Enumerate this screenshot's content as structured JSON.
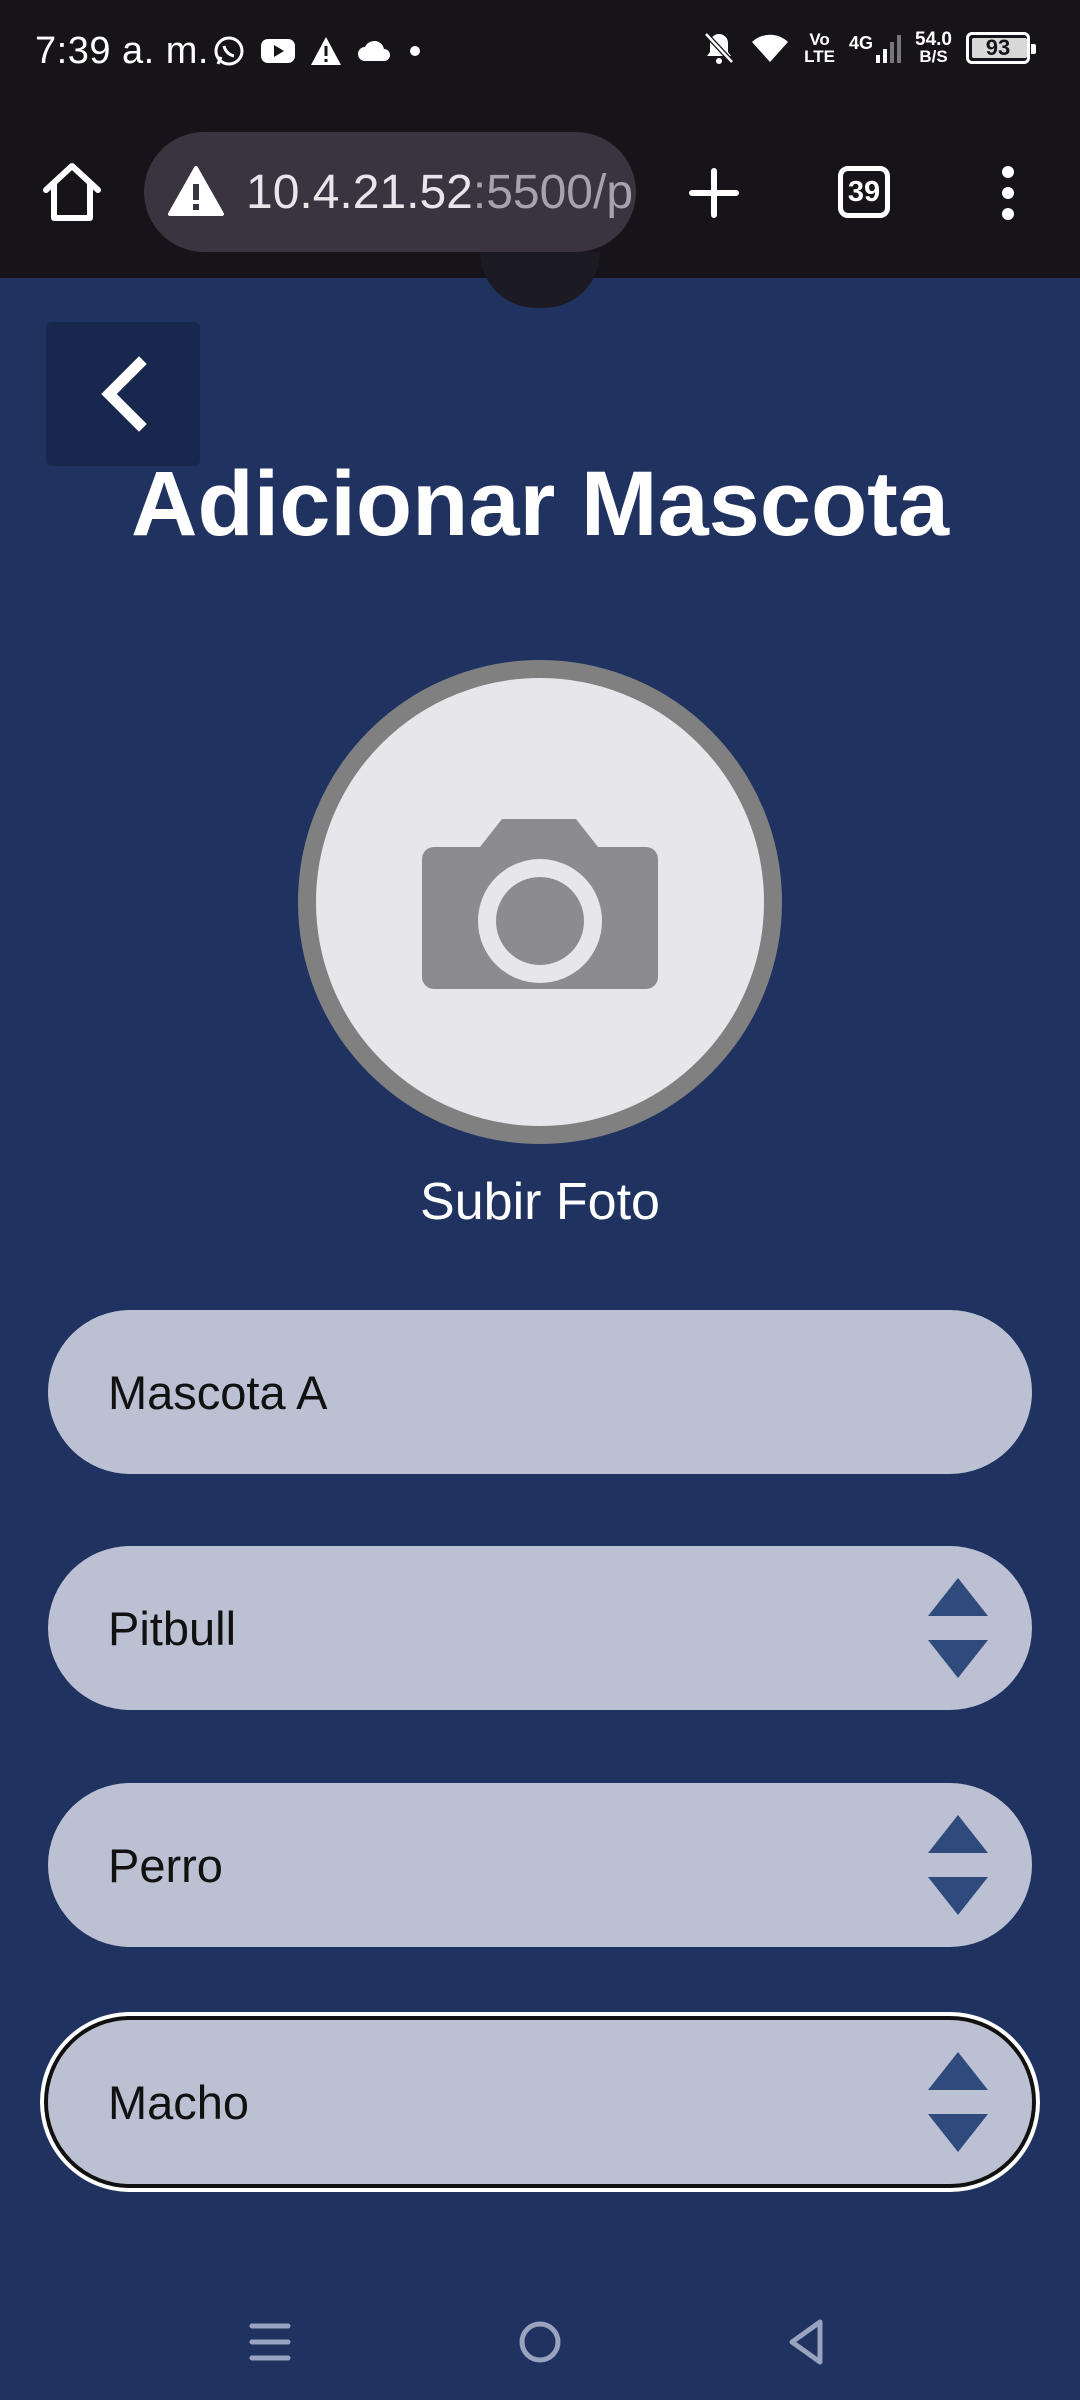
{
  "status_bar": {
    "time": "7:39 a. m.",
    "left_icons": [
      "whatsapp-icon",
      "youtube-icon",
      "warning-icon",
      "cloud-icon",
      "dot-icon"
    ],
    "volte_top": "Vo",
    "volte_bottom": "LTE",
    "network": "4G",
    "speed_value": "54.0",
    "speed_unit": "B/S",
    "battery": "93"
  },
  "browser": {
    "url_host": "10.4.21.52",
    "url_rest": ":5500/p",
    "tab_count": "39"
  },
  "page": {
    "title": "Adicionar Mascota",
    "upload_label": "Subir Foto",
    "fields": {
      "name_value": "Mascota A",
      "breed_value": "Pitbull",
      "species_value": "Perro",
      "sex_value": "Macho"
    }
  },
  "colors": {
    "background": "#1f3260",
    "field": "#bbc0d2",
    "spinner": "#2f4a7c",
    "camera": "#8c8c8f"
  }
}
